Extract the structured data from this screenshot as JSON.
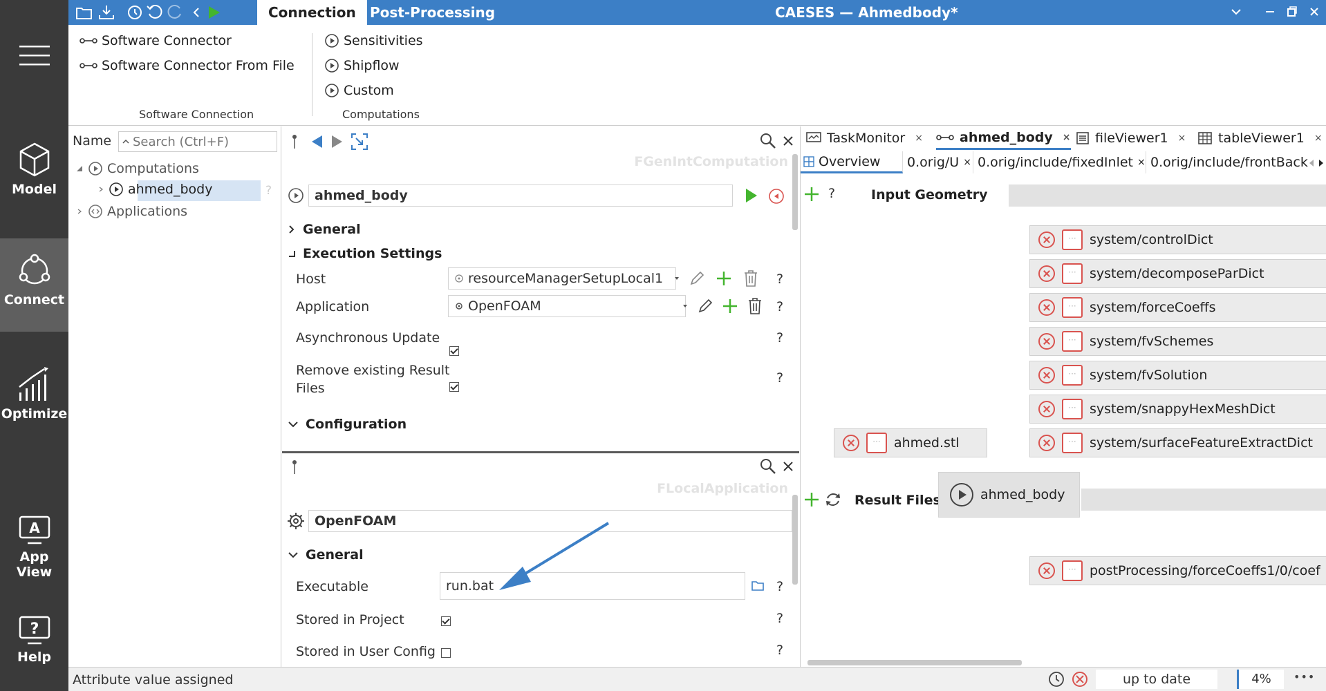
{
  "sidebar": {
    "items": [
      {
        "label": "Model"
      },
      {
        "label": "Connect"
      },
      {
        "label": "Optimize"
      },
      {
        "label": "App View"
      },
      {
        "label": "Help"
      }
    ]
  },
  "topbar": {
    "tabs": [
      "Connection",
      "Post-Processing"
    ],
    "title": "CAESES — Ahmedbody*"
  },
  "ribbon": {
    "software_connection": {
      "items": [
        "Software Connector",
        "Software Connector From File"
      ],
      "group_label": "Software Connection"
    },
    "computations": {
      "items": [
        "Sensitivities",
        "Shipflow",
        "Custom"
      ],
      "group_label": "Computations"
    }
  },
  "tree": {
    "name_label": "Name",
    "search_placeholder": "Search (Ctrl+F)",
    "nodes": [
      "Computations",
      "ahmed_body",
      "Applications"
    ],
    "help": "?"
  },
  "computation_panel": {
    "type_label": "FGenIntComputation",
    "name_value": "ahmed_body",
    "sections": {
      "general": "General",
      "execution": "Execution Settings",
      "configuration": "Configuration"
    },
    "rows": {
      "host": {
        "label": "Host",
        "value": "resourceManagerSetupLocal1"
      },
      "application": {
        "label": "Application",
        "value": "OpenFOAM"
      },
      "async": {
        "label": "Asynchronous Update",
        "checked": true
      },
      "remove": {
        "label_line1": "Remove existing Result",
        "label_line2": "Files",
        "checked": true
      }
    },
    "help": "?"
  },
  "application_panel": {
    "type_label": "FLocalApplication",
    "name_value": "OpenFOAM",
    "section_general": "General",
    "rows": {
      "executable": {
        "label": "Executable",
        "value": "run.bat"
      },
      "stored_project": {
        "label": "Stored in Project",
        "checked": true
      },
      "stored_user": {
        "label": "Stored in User Config",
        "checked": false
      }
    },
    "help": "?"
  },
  "right": {
    "tabs": [
      "TaskMonitor",
      "ahmed_body",
      "fileViewer1",
      "tableViewer1"
    ],
    "subtabs": [
      "Overview",
      "0.orig/U",
      "0.orig/include/fixedInlet",
      "0.orig/include/frontBack"
    ],
    "input_geometry_label": "Input Geometry",
    "result_files_label": "Result Files",
    "help": "?",
    "input_files": [
      "system/controlDict",
      "system/decomposeParDict",
      "system/forceCoeffs",
      "system/fvSchemes",
      "system/fvSolution",
      "system/snappyHexMeshDict",
      "system/surfaceFeatureExtractDict"
    ],
    "geometry_file": "ahmed.stl",
    "computation_node": "ahmed_body",
    "result_file": "postProcessing/forceCoeffs1/0/coef"
  },
  "status": {
    "message": "Attribute value assigned",
    "state": "up to date",
    "zoom": "4%",
    "more": "•••"
  },
  "colors": {
    "accent": "#3c7fc6",
    "run_green": "#44b52f",
    "delete_red": "#d9534f",
    "sidebar": "#3a3a3a"
  }
}
